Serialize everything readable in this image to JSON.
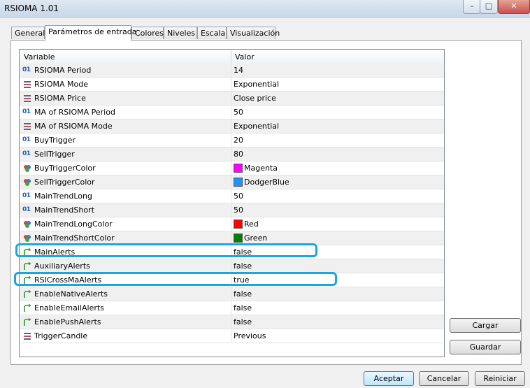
{
  "window": {
    "title": "RSIOMA 1.01",
    "min_label": "–",
    "max_label": "□",
    "close_label": "✕"
  },
  "tabs": [
    {
      "label": "General"
    },
    {
      "label": "Parámetros de entrada"
    },
    {
      "label": "Colores"
    },
    {
      "label": "Niveles"
    },
    {
      "label": "Escala"
    },
    {
      "label": "Visualización"
    }
  ],
  "active_tab": "Parámetros de entrada",
  "grid": {
    "col_variable": "Variable",
    "col_valor": "Valor",
    "rows": [
      {
        "icon": "int-icon",
        "name": "RSIOMA Period",
        "value": "14"
      },
      {
        "icon": "enum-icon",
        "name": "RSIOMA Mode",
        "value": "Exponential"
      },
      {
        "icon": "enum-icon",
        "name": "RSIOMA Price",
        "value": "Close price"
      },
      {
        "icon": "int-icon",
        "name": "MA of RSIOMA Period",
        "value": "50"
      },
      {
        "icon": "enum-icon",
        "name": "MA of RSIOMA Mode",
        "value": "Exponential"
      },
      {
        "icon": "int-icon",
        "name": "BuyTrigger",
        "value": "20"
      },
      {
        "icon": "int-icon",
        "name": "SellTrigger",
        "value": "80"
      },
      {
        "icon": "color-icon",
        "name": "BuyTriggerColor",
        "value": "Magenta",
        "color": "#ff00ff"
      },
      {
        "icon": "color-icon",
        "name": "SellTriggerColor",
        "value": "DodgerBlue",
        "color": "#1e90ff"
      },
      {
        "icon": "int-icon",
        "name": "MainTrendLong",
        "value": "50"
      },
      {
        "icon": "int-icon",
        "name": "MainTrendShort",
        "value": "50"
      },
      {
        "icon": "color-icon",
        "name": "MainTrendLongColor",
        "value": "Red",
        "color": "#ff0000"
      },
      {
        "icon": "color-icon",
        "name": "MainTrendShortColor",
        "value": "Green",
        "color": "#008000"
      },
      {
        "icon": "bool-icon",
        "name": "MainAlerts",
        "value": "false"
      },
      {
        "icon": "bool-icon",
        "name": "AuxiliaryAlerts",
        "value": "false"
      },
      {
        "icon": "bool-icon",
        "name": "RSICrossMaAlerts",
        "value": "true"
      },
      {
        "icon": "bool-icon",
        "name": "EnableNativeAlerts",
        "value": "false"
      },
      {
        "icon": "bool-icon",
        "name": "EnableEmailAlerts",
        "value": "false"
      },
      {
        "icon": "bool-icon",
        "name": "EnablePushAlerts",
        "value": "false"
      },
      {
        "icon": "enum-icon",
        "name": "TriggerCandle",
        "value": "Previous"
      }
    ]
  },
  "side_buttons": {
    "load_label": "Cargar",
    "save_label": "Guardar"
  },
  "footer_buttons": {
    "accept_label": "Aceptar",
    "cancel_label": "Cancelar",
    "reset_label": "Reiniciar"
  },
  "highlight_color": "#1aa7e0"
}
